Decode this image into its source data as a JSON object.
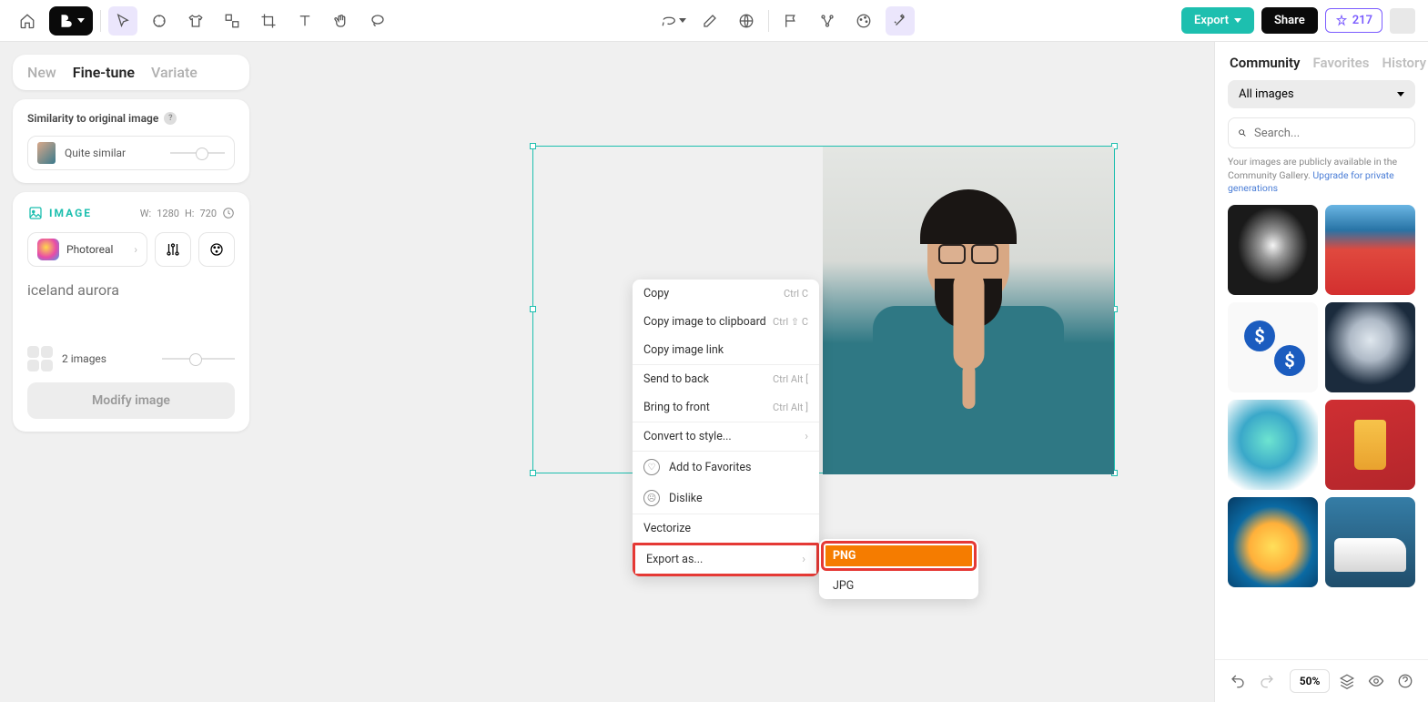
{
  "toolbar": {
    "export_label": "Export",
    "share_label": "Share",
    "credits": "217"
  },
  "left": {
    "tabs": {
      "new": "New",
      "finetune": "Fine-tune",
      "variate": "Variate"
    },
    "similarity": {
      "label": "Similarity to original image",
      "value": "Quite similar"
    },
    "image_section": {
      "title": "IMAGE",
      "w_label": "W:",
      "w": "1280",
      "h_label": "H:",
      "h": "720",
      "style": "Photoreal",
      "prompt_placeholder": "iceland aurora",
      "count_label": "2 images",
      "modify": "Modify image"
    }
  },
  "context_menu": {
    "copy": "Copy",
    "copy_sc": "Ctrl C",
    "copy_img": "Copy image to clipboard",
    "copy_img_sc": "Ctrl ⇧ C",
    "copy_link": "Copy image link",
    "send_back": "Send to back",
    "send_back_sc": "Ctrl Alt [",
    "bring_front": "Bring to front",
    "bring_front_sc": "Ctrl Alt ]",
    "convert": "Convert to style...",
    "fav": "Add to Favorites",
    "dislike": "Dislike",
    "vectorize": "Vectorize",
    "export_as": "Export as...",
    "submenu": {
      "png": "PNG",
      "jpg": "JPG"
    }
  },
  "right": {
    "tabs": {
      "community": "Community",
      "favorites": "Favorites",
      "history": "History"
    },
    "filter": "All images",
    "search_placeholder": "Search...",
    "notice_pre": "Your images are publicly available in the Community Gallery. ",
    "notice_link": "Upgrade for private generations",
    "zoom": "50%"
  }
}
